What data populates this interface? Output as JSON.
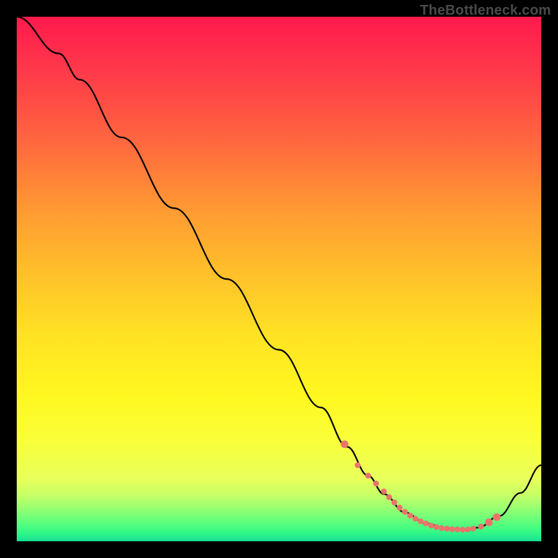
{
  "attribution": "TheBottleneck.com",
  "colors": {
    "dot": "#e9746b",
    "line": "#000000"
  },
  "chart_data": {
    "type": "line",
    "title": "",
    "xlabel": "",
    "ylabel": "",
    "xlim": [
      0,
      100
    ],
    "ylim": [
      0,
      100
    ],
    "series": [
      {
        "name": "curve",
        "x": [
          0,
          8,
          12,
          20,
          30,
          40,
          50,
          58,
          63,
          67,
          70,
          74,
          78,
          82,
          85,
          88,
          92,
          96,
          100
        ],
        "y": [
          100,
          93,
          88,
          77,
          63.5,
          50,
          36.5,
          25.5,
          18,
          12.5,
          9,
          5.5,
          3.4,
          2.4,
          2.2,
          2.6,
          4.8,
          9.2,
          14.5
        ]
      }
    ],
    "dots": {
      "name": "highlight-dots",
      "x": [
        62.5,
        65,
        67,
        68.5,
        70,
        71,
        72,
        73,
        74,
        75,
        76,
        77,
        78,
        79,
        80,
        81,
        82,
        83,
        84,
        85,
        86,
        87,
        88.5,
        90,
        91.5
      ],
      "y": [
        18.5,
        14.5,
        12.5,
        11,
        9.5,
        8.4,
        7.4,
        6.4,
        5.6,
        4.9,
        4.3,
        3.8,
        3.4,
        3.0,
        2.7,
        2.5,
        2.4,
        2.3,
        2.25,
        2.2,
        2.25,
        2.4,
        2.8,
        3.6,
        4.6
      ]
    }
  }
}
